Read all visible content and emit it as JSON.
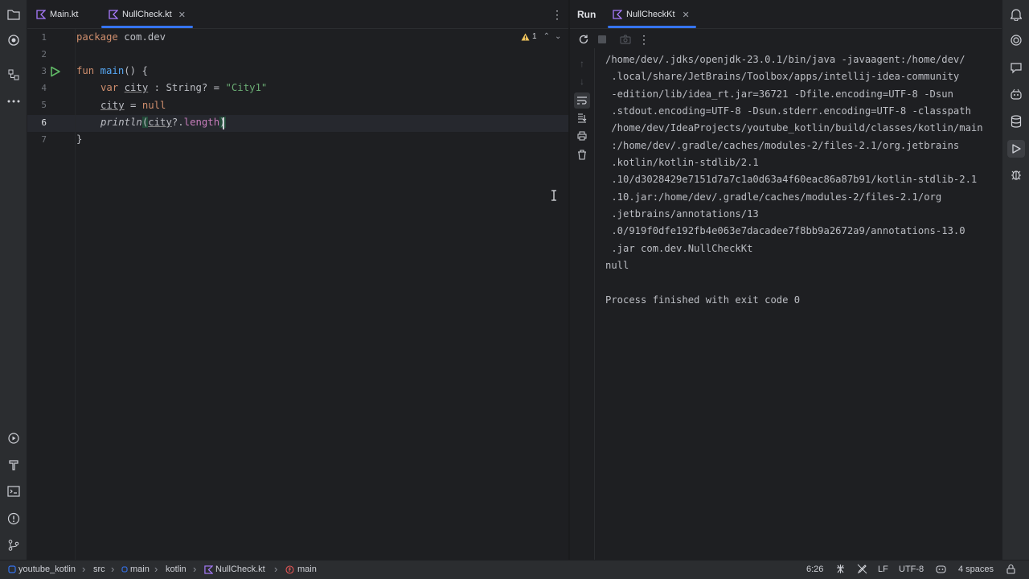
{
  "left_bar": {
    "top_icons": [
      "folder-icon",
      "plugin-logo-icon",
      "structure-icon",
      "more-icon"
    ],
    "bottom_icons": [
      "services-icon",
      "build-icon",
      "terminal-icon",
      "problems-icon",
      "git-icon"
    ]
  },
  "editor_tabs": [
    {
      "label": "Main.kt",
      "active": false
    },
    {
      "label": "NullCheck.kt",
      "active": true
    }
  ],
  "editor": {
    "line_numbers": [
      "1",
      "2",
      "3",
      "4",
      "5",
      "6",
      "7"
    ],
    "lines": {
      "l1_kw": "package",
      "l1_rest": " com.dev",
      "l3_kw": "fun",
      "l3_fn": "main",
      "l3_rest": "() {",
      "l4_kw": "var",
      "l4_var": "city",
      "l4_mid": " : String? = ",
      "l4_str": "\"City1\"",
      "l5_var": "city",
      "l5_mid": " = ",
      "l5_kw": "null",
      "l6_fn": "println",
      "l6_open": "(",
      "l6_var": "city",
      "l6_op": "?.",
      "l6_prop": "length",
      "l6_close": ")",
      "l7": "}"
    },
    "warning_count": "1"
  },
  "run_panel": {
    "title": "Run",
    "tab_label": "NullCheckKt",
    "console": [
      "/home/dev/.jdks/openjdk-23.0.1/bin/java -javaagent:/home/dev/",
      " .local/share/JetBrains/Toolbox/apps/intellij-idea-community",
      " -edition/lib/idea_rt.jar=36721 -Dfile.encoding=UTF-8 -Dsun",
      " .stdout.encoding=UTF-8 -Dsun.stderr.encoding=UTF-8 -classpath",
      " /home/dev/IdeaProjects/youtube_kotlin/build/classes/kotlin/main",
      " :/home/dev/.gradle/caches/modules-2/files-2.1/org.jetbrains",
      " .kotlin/kotlin-stdlib/2.1",
      " .10/d3028429e7151d7a7c1a0d63a4f60eac86a87b91/kotlin-stdlib-2.1",
      " .10.jar:/home/dev/.gradle/caches/modules-2/files-2.1/org",
      " .jetbrains/annotations/13",
      " .0/919f0dfe192fb4e063e7dacadee7f8bb9a2672a9/annotations-13.0",
      " .jar com.dev.NullCheckKt",
      "null",
      "",
      "Process finished with exit code 0"
    ]
  },
  "breadcrumbs": [
    "youtube_kotlin",
    "src",
    "main",
    "kotlin",
    "NullCheck.kt",
    "main"
  ],
  "status": {
    "position": "6:26",
    "line_ending": "LF",
    "encoding": "UTF-8",
    "indent": "4 spaces"
  },
  "colors": {
    "accent": "#3574f0",
    "run_green": "#5fb865",
    "warning": "#f2c55c"
  }
}
